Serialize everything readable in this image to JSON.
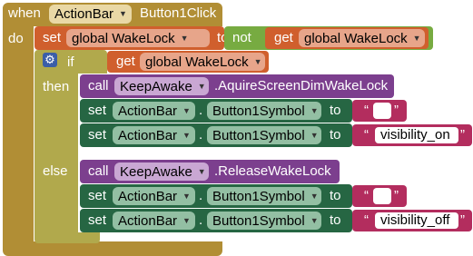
{
  "when_block": {
    "when_label": "when",
    "component": "ActionBar",
    "dot": ".",
    "event": "Button1Click",
    "do_label": "do"
  },
  "set_wakelock": {
    "set_label": "set",
    "variable": "global WakeLock",
    "to_label": "to",
    "not_label": "not",
    "get_label": "get",
    "get_variable": "global WakeLock"
  },
  "if_block": {
    "if_label": "if",
    "get_label": "get",
    "get_variable": "global WakeLock",
    "then_label": "then",
    "else_label": "else"
  },
  "then_branch": {
    "call_label": "call",
    "component": "KeepAwake",
    "method": ".AquireScreenDimWakeLock",
    "rows": [
      {
        "set_label": "set",
        "component": "ActionBar",
        "dot": ".",
        "property": "Button1Symbol",
        "to_label": "to",
        "string": ""
      },
      {
        "set_label": "set",
        "component": "ActionBar",
        "dot": ".",
        "property": "Button1Symbol",
        "to_label": "to",
        "string": "visibility_on"
      }
    ]
  },
  "else_branch": {
    "call_label": "call",
    "component": "KeepAwake",
    "method": ".ReleaseWakeLock",
    "rows": [
      {
        "set_label": "set",
        "component": "ActionBar",
        "dot": ".",
        "property": "Button1Symbol",
        "to_label": "to",
        "string": ""
      },
      {
        "set_label": "set",
        "component": "ActionBar",
        "dot": ".",
        "property": "Button1Symbol",
        "to_label": "to",
        "string": "visibility_off"
      }
    ]
  },
  "quote_open": "“",
  "quote_close": "”",
  "colors": {
    "event_gold": "#b18e35",
    "variable_orange": "#d05f2d",
    "logic_green": "#77ab41",
    "control_olive": "#b1a94c",
    "procedure_purple": "#7c3f8e",
    "setter_green": "#266643",
    "text_red": "#b32d5e",
    "dropdown_gold": "#e9d8a6"
  }
}
